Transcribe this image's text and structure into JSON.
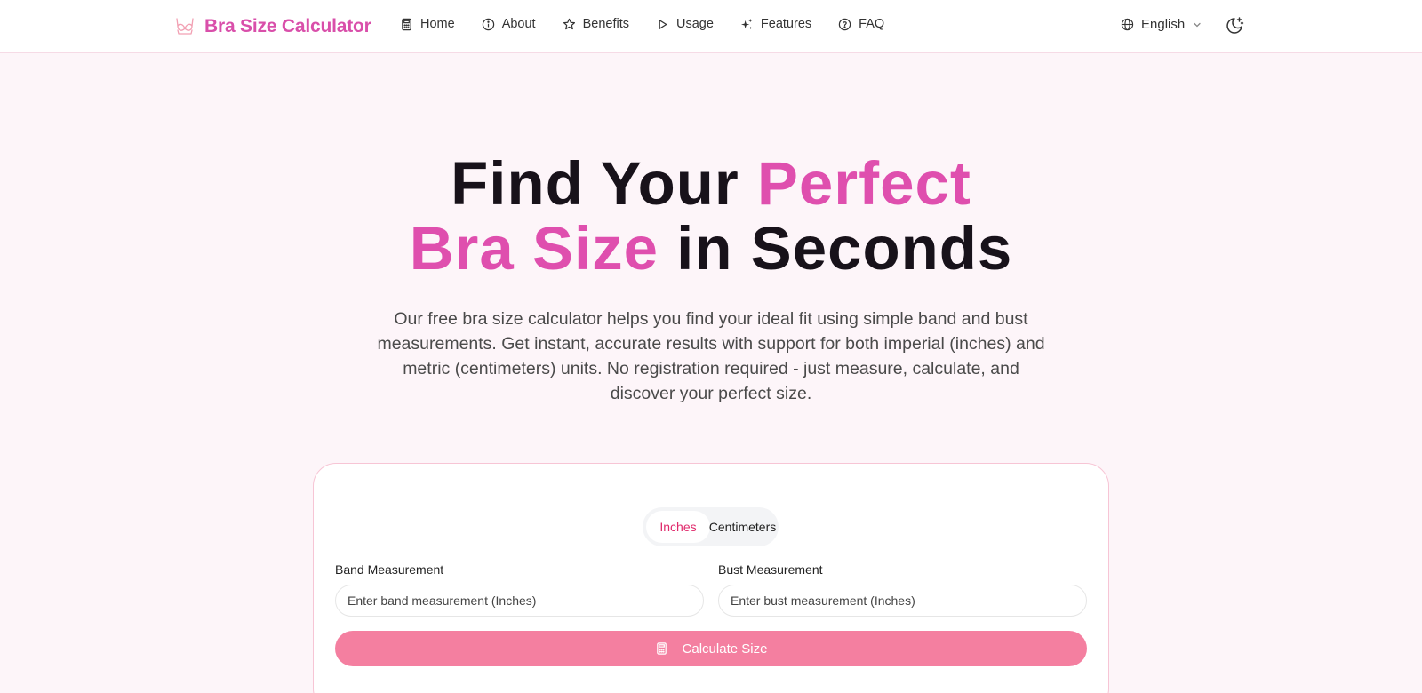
{
  "brand": {
    "name": "Bra Size Calculator",
    "icon": "bra-icon"
  },
  "nav": {
    "items": [
      {
        "label": "Home",
        "icon": "calculator-icon"
      },
      {
        "label": "About",
        "icon": "info-icon"
      },
      {
        "label": "Benefits",
        "icon": "star-icon"
      },
      {
        "label": "Usage",
        "icon": "play-icon"
      },
      {
        "label": "Features",
        "icon": "sparkles-icon"
      },
      {
        "label": "FAQ",
        "icon": "help-circle-icon"
      }
    ],
    "language": "English",
    "theme_icon": "moon-icon"
  },
  "hero": {
    "title_part1": "Find Your ",
    "title_accent1": "Perfect",
    "title_accent2": "Bra Size",
    "title_part2": " in Seconds",
    "subtitle": "Our free bra size calculator helps you find your ideal fit using simple band and bust measurements. Get instant, accurate results with support for both imperial (inches) and metric (centimeters) units. No registration required - just measure, calculate, and discover your perfect size."
  },
  "calculator": {
    "units": {
      "active": "Inches",
      "inactive": "Centimeters"
    },
    "band": {
      "label": "Band Measurement",
      "placeholder": "Enter band measurement (Inches)",
      "value": ""
    },
    "bust": {
      "label": "Bust Measurement",
      "placeholder": "Enter bust measurement (Inches)",
      "value": ""
    },
    "button_label": "Calculate Size"
  },
  "colors": {
    "accent": "#df4fae",
    "brand_text": "#d94faa",
    "button": "#f47fa0",
    "active_unit": "#e0296b",
    "background": "#fdf5f9"
  }
}
